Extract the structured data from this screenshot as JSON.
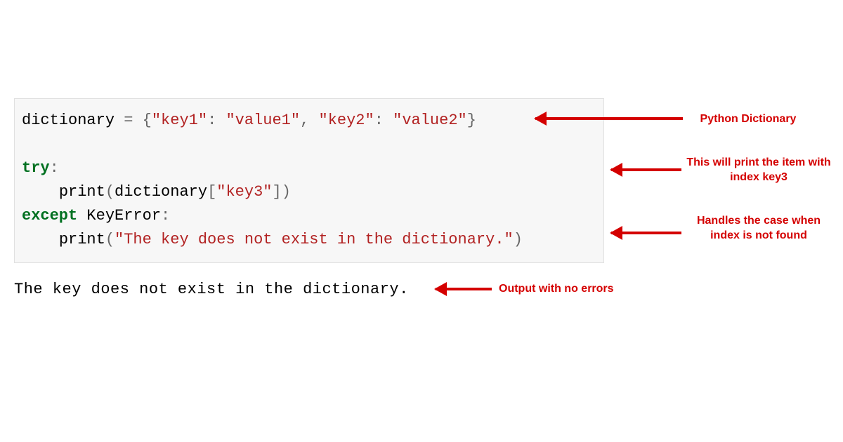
{
  "code": {
    "var_name": "dictionary",
    "equals": " = ",
    "brace_open": "{",
    "key1": "\"key1\"",
    "colon1": ": ",
    "val1": "\"value1\"",
    "comma": ", ",
    "key2": "\"key2\"",
    "colon2": ": ",
    "val2": "\"value2\"",
    "brace_close": "}",
    "try_kw": "try",
    "colon_try": ":",
    "indent": "    ",
    "print1": "print",
    "paren_open": "(",
    "lookup_var": "dictionary",
    "bracket_open": "[",
    "key3": "\"key3\"",
    "bracket_close": "]",
    "paren_close": ")",
    "except_kw": "except",
    "space": " ",
    "exc_name": "KeyError",
    "colon_exc": ":",
    "print2": "print",
    "err_str": "\"The key does not exist in the dictionary.\""
  },
  "output": "The key does not exist in the dictionary.",
  "annotations": {
    "a1": "Python Dictionary",
    "a2": "This will print the item with index key3",
    "a3": "Handles the case when index is not found",
    "a4": "Output with no errors"
  }
}
